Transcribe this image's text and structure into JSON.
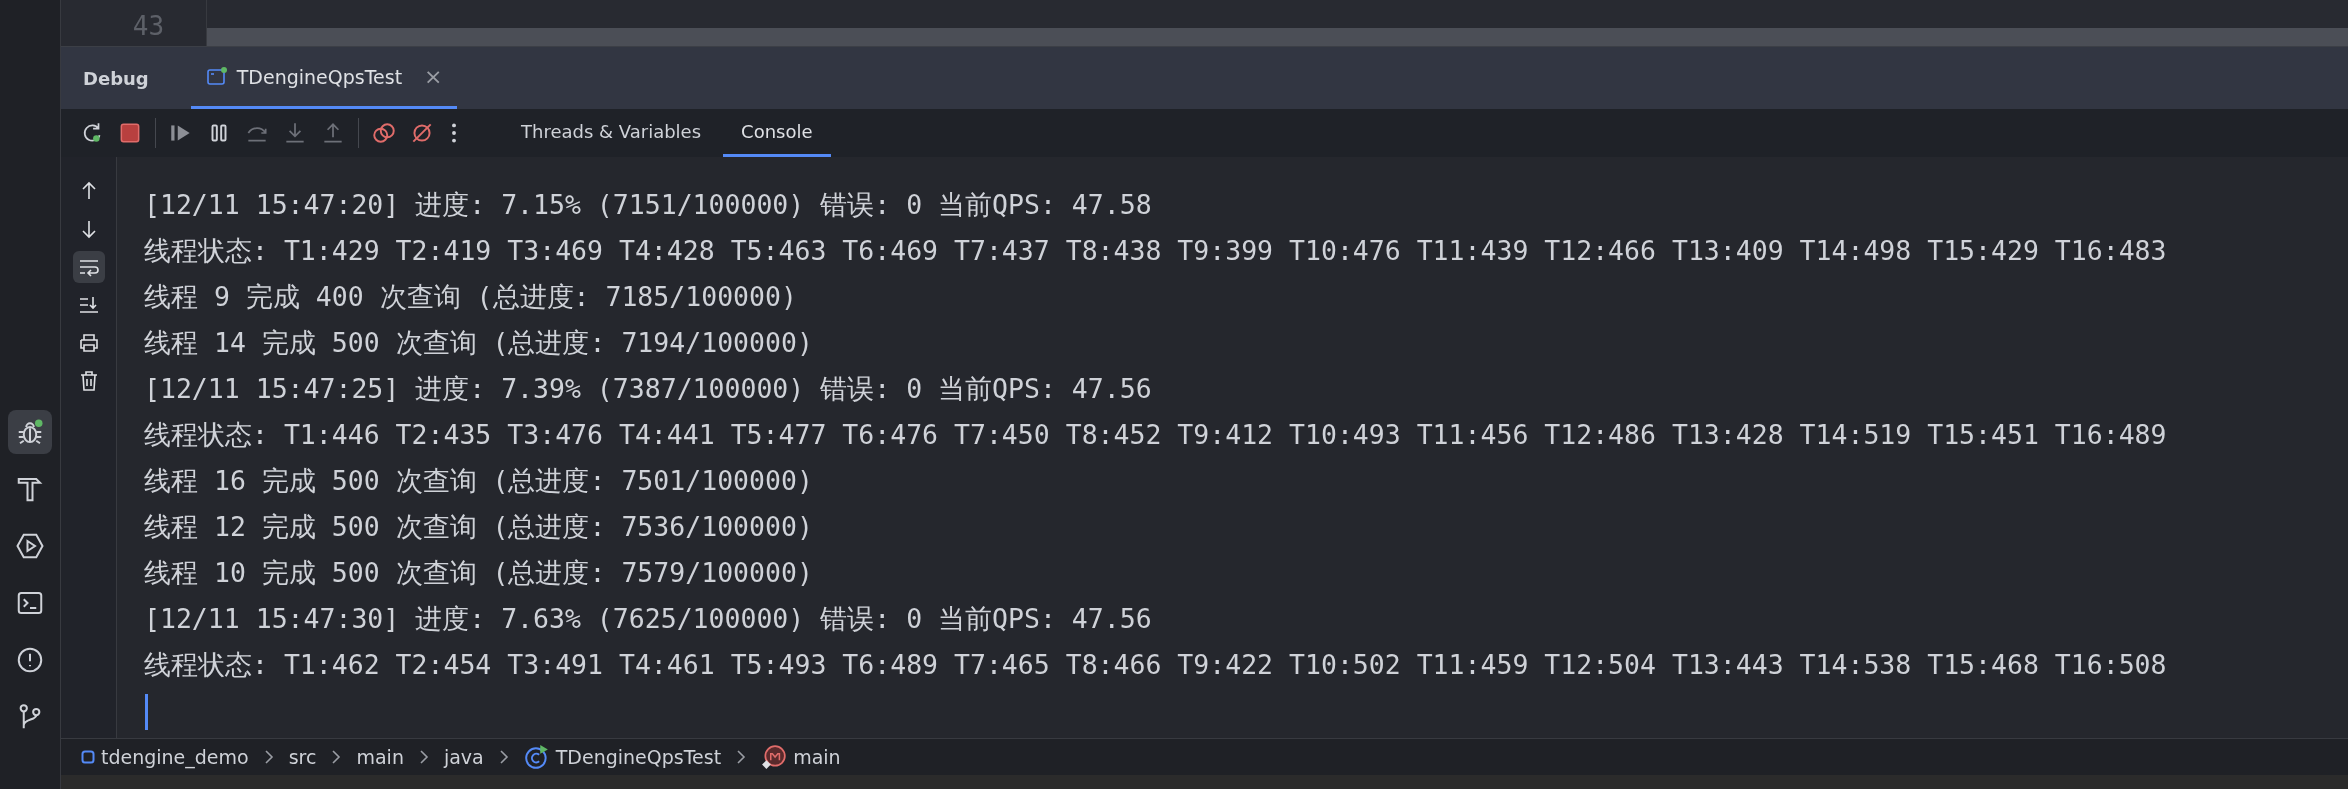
{
  "editor": {
    "line_numbers": [
      "43"
    ]
  },
  "tool_window": {
    "title": "Debug",
    "tabs": [
      {
        "label": "TDengineQpsTest",
        "selected": true,
        "close": "×"
      }
    ]
  },
  "view_tabs": [
    {
      "label": "Threads & Variables",
      "selected": false
    },
    {
      "label": "Console",
      "selected": true
    }
  ],
  "tool_strip": [
    {
      "kind": "debug",
      "selected": true
    },
    {
      "kind": "build",
      "selected": false
    },
    {
      "kind": "services",
      "selected": false
    },
    {
      "kind": "terminal",
      "selected": false
    },
    {
      "kind": "problems",
      "selected": false
    },
    {
      "kind": "git",
      "selected": false
    }
  ],
  "console_actions": [
    {
      "kind": "up",
      "selected": false
    },
    {
      "kind": "down",
      "selected": false
    },
    {
      "kind": "wrap",
      "selected": true
    },
    {
      "kind": "scroll-end",
      "selected": false
    },
    {
      "kind": "print",
      "selected": false
    },
    {
      "kind": "clear",
      "selected": false
    }
  ],
  "console_lines": [
    "[12/11 15:47:20] 进度: 7.15% (7151/100000) 错误: 0 当前QPS: 47.58",
    "线程状态: T1:429 T2:419 T3:469 T4:428 T5:463 T6:469 T7:437 T8:438 T9:399 T10:476 T11:439 T12:466 T13:409 T14:498 T15:429 T16:483",
    "线程 9 完成 400 次查询 (总进度: 7185/100000)",
    "线程 14 完成 500 次查询 (总进度: 7194/100000)",
    "[12/11 15:47:25] 进度: 7.39% (7387/100000) 错误: 0 当前QPS: 47.56",
    "线程状态: T1:446 T2:435 T3:476 T4:441 T5:477 T6:476 T7:450 T8:452 T9:412 T10:493 T11:456 T12:486 T13:428 T14:519 T15:451 T16:489",
    "线程 16 完成 500 次查询 (总进度: 7501/100000)",
    "线程 12 完成 500 次查询 (总进度: 7536/100000)",
    "线程 10 完成 500 次查询 (总进度: 7579/100000)",
    "[12/11 15:47:30] 进度: 7.63% (7625/100000) 错误: 0 当前QPS: 47.56",
    "线程状态: T1:462 T2:454 T3:491 T4:461 T5:493 T6:489 T7:465 T8:466 T9:422 T10:502 T11:459 T12:504 T13:443 T14:538 T15:468 T16:508"
  ],
  "breadcrumbs": [
    {
      "label": "tdengine_demo",
      "kind": "module"
    },
    {
      "label": "src",
      "kind": "folder"
    },
    {
      "label": "main",
      "kind": "folder"
    },
    {
      "label": "java",
      "kind": "folder"
    },
    {
      "label": "TDengineQpsTest",
      "kind": "class"
    },
    {
      "label": "main",
      "kind": "method"
    }
  ]
}
